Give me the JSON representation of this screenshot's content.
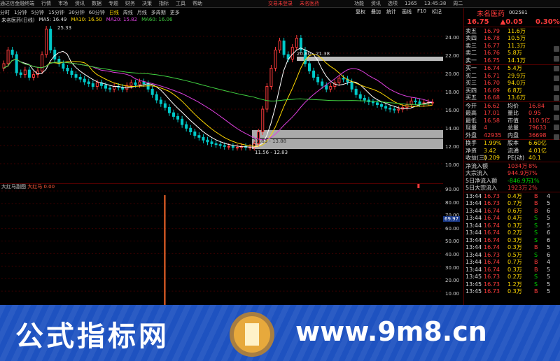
{
  "title_bar": {
    "app": "通达信金融终端",
    "menus": [
      "行情",
      "市场",
      "资讯",
      "数据",
      "专题",
      "财务",
      "决策",
      "指标",
      "工具",
      "帮助"
    ],
    "center_left": "交易未登录",
    "center_right": "未名医药",
    "right": [
      "功能",
      "资讯",
      "选项",
      "1365",
      "13:45:38",
      "周二"
    ]
  },
  "toolbar": {
    "periods": [
      "分时",
      "1分钟",
      "5分钟",
      "15分钟",
      "30分钟",
      "60分钟",
      "日线",
      "周线",
      "月线",
      "多周期",
      "更多"
    ],
    "active": "日线",
    "right": [
      "复权",
      "叠加",
      "统计",
      "画线",
      "F10",
      "标记"
    ]
  },
  "legend": {
    "stock": "未名医药(日线)",
    "ma5": "MA5: 16.49",
    "ma10": "MA10: 16.50",
    "ma20": "MA20: 15.82",
    "ma60": "MA60: 16.06"
  },
  "chart_annotations": {
    "high": "25.33",
    "box1": "20.80 - 21.38",
    "box2": "12.83 - 13.88",
    "low": "11.56 - 12.83"
  },
  "y_labels": [
    "24.00",
    "22.00",
    "20.00",
    "18.00",
    "16.00",
    "14.00",
    "12.00",
    "10.00"
  ],
  "sub_y_labels": [
    "90.00",
    "80.00",
    "70.00",
    "60.00",
    "50.00",
    "40.00",
    "30.00",
    "20.00",
    "10.00"
  ],
  "sub_marker": "69.97",
  "sub_indicator": {
    "name": "大红马副图",
    "label": "大红马",
    "value": "0.00"
  },
  "right_panel": {
    "stock_name": "未名医药",
    "code": "002581",
    "price": "16.75",
    "change": "▲0.05",
    "pct": "0.30%",
    "asks": [
      [
        "卖五",
        "16.79",
        "11.6万"
      ],
      [
        "卖四",
        "16.78",
        "10.5万"
      ],
      [
        "卖三",
        "16.77",
        "11.3万"
      ],
      [
        "卖二",
        "16.76",
        "5.8万"
      ],
      [
        "卖一",
        "16.75",
        "14.1万"
      ]
    ],
    "bids": [
      [
        "买一",
        "16.74",
        "5.4万"
      ],
      [
        "买二",
        "16.71",
        "29.9万"
      ],
      [
        "买三",
        "16.70",
        "94.0万"
      ],
      [
        "买四",
        "16.69",
        "6.8万"
      ],
      [
        "买五",
        "16.68",
        "13.6万"
      ]
    ],
    "stats": [
      [
        "今开",
        "16.62",
        "均价",
        "16.84"
      ],
      [
        "最高",
        "17.01",
        "量比",
        "0.95"
      ],
      [
        "最低",
        "16.58",
        "市值",
        "110.5亿"
      ],
      [
        "现量",
        "4",
        "总量",
        "79633"
      ],
      [
        "外盘",
        "42935",
        "内盘",
        "36698"
      ]
    ],
    "stats2": [
      [
        "换手",
        "1.99%",
        "股本",
        "6.60亿"
      ],
      [
        "净资",
        "3.42",
        "流通",
        "4.01亿"
      ],
      [
        "收益(三)",
        "0.209",
        "PE(动)",
        "40.1"
      ]
    ],
    "flows": [
      [
        "净流入额",
        "1034万",
        "8%"
      ],
      [
        "大宗流入",
        "944.9万",
        "7%"
      ],
      [
        "5日净流入额",
        "-846.9万",
        "-1%"
      ],
      [
        "5日大宗流入",
        "1923万",
        "2%"
      ]
    ],
    "ticks": [
      [
        "13:44",
        "16.73",
        "0.4万",
        "B",
        "4"
      ],
      [
        "13:44",
        "16.73",
        "0.7万",
        "B",
        "5"
      ],
      [
        "13:44",
        "16.74",
        "0.6万",
        "B",
        "6"
      ],
      [
        "13:44",
        "16.74",
        "0.4万",
        "S",
        "5"
      ],
      [
        "13:44",
        "16.74",
        "0.3万",
        "S",
        "5"
      ],
      [
        "13:44",
        "16.74",
        "0.2万",
        "S",
        "6"
      ],
      [
        "13:44",
        "16.74",
        "0.3万",
        "S",
        "6"
      ],
      [
        "13:44",
        "16.74",
        "0.3万",
        "B",
        "5"
      ],
      [
        "13:44",
        "16.73",
        "0.5万",
        "S",
        "6"
      ],
      [
        "13:44",
        "16.74",
        "0.7万",
        "B",
        "4"
      ],
      [
        "13:44",
        "16.74",
        "0.3万",
        "B",
        "5"
      ],
      [
        "13:45",
        "16.73",
        "0.2万",
        "S",
        "5"
      ],
      [
        "13:45",
        "16.73",
        "1.2万",
        "S",
        "5"
      ],
      [
        "13:45",
        "16.73",
        "0.3万",
        "B",
        "5"
      ]
    ]
  },
  "banner": {
    "left": "公式指标网",
    "right": "www.9m8.cn"
  }
}
